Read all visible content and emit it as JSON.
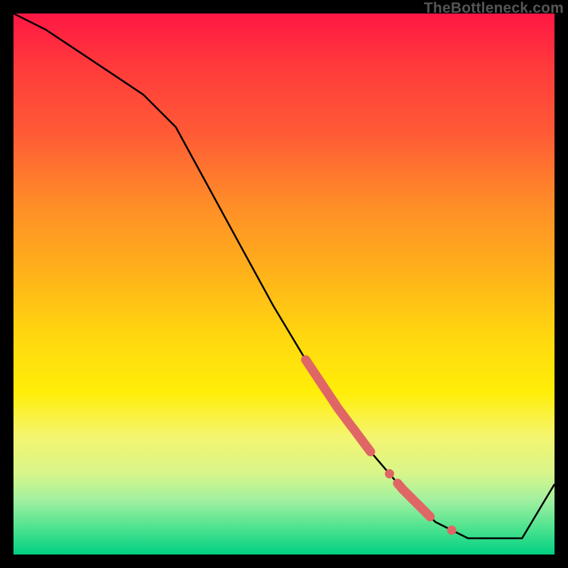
{
  "watermark": "TheBottleneck.com",
  "colors": {
    "frame": "#000000",
    "line": "#000000",
    "marker": "#e06666",
    "gradient_top": "#ff1744",
    "gradient_bottom": "#00d082"
  },
  "chart_data": {
    "type": "line",
    "title": "",
    "xlabel": "",
    "ylabel": "",
    "xlim": [
      0,
      100
    ],
    "ylim": [
      0,
      100
    ],
    "x": [
      0,
      6,
      12,
      18,
      24,
      30,
      36,
      42,
      48,
      54,
      60,
      66,
      72,
      78,
      84,
      90,
      94,
      100
    ],
    "values": [
      100,
      97,
      93,
      89,
      85,
      79,
      68,
      57,
      46,
      36,
      27,
      19,
      12,
      6,
      3,
      3,
      3,
      13
    ],
    "highlighted_segments": [
      {
        "x_start": 54,
        "x_end": 66,
        "style": "thick"
      },
      {
        "x_start": 69,
        "x_end": 70,
        "style": "dot"
      },
      {
        "x_start": 71,
        "x_end": 77,
        "style": "thick"
      },
      {
        "x_start": 80,
        "x_end": 82,
        "style": "dot"
      }
    ],
    "annotations": []
  }
}
